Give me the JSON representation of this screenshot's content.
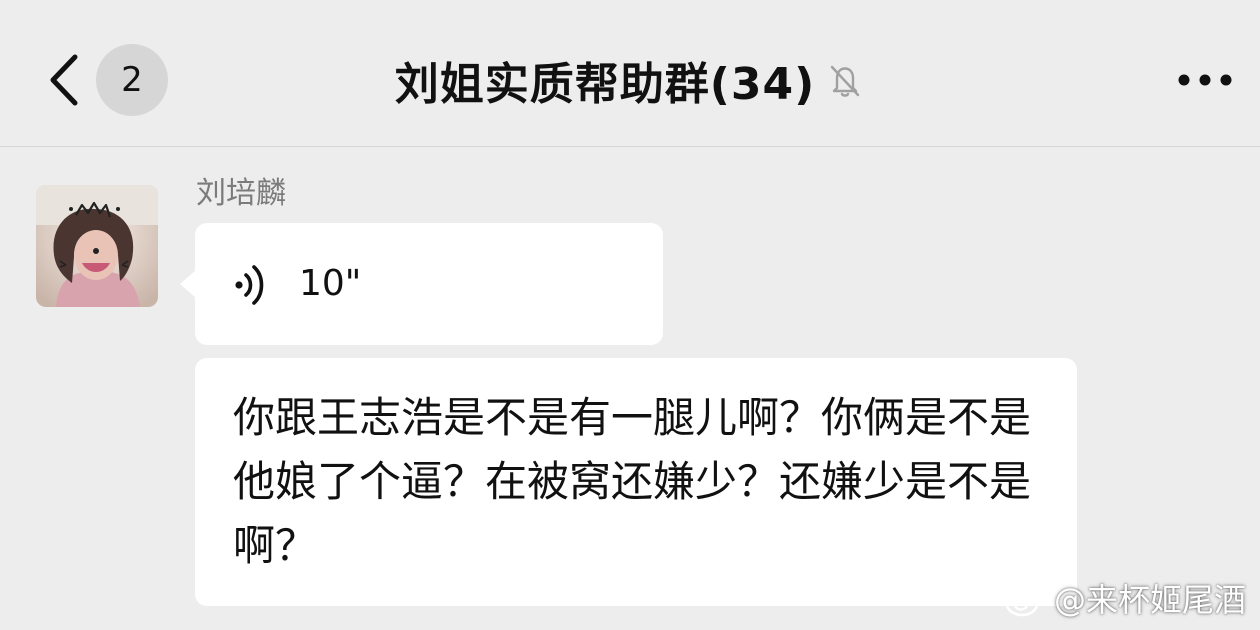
{
  "header": {
    "back_count": "2",
    "title": "刘姐实质帮助群(34)",
    "icons": {
      "back": "chevron-left-icon",
      "mute": "bell-slash-icon",
      "more": "more-dots-icon"
    }
  },
  "message": {
    "sender_name": "刘培麟",
    "avatar": "user-avatar",
    "voice": {
      "icon": "voice-wave-icon",
      "duration": "10\""
    },
    "text": "你跟王志浩是不是有一腿儿啊？你俩是不是他娘了个逼？在被窝还嫌少？还嫌少是不是啊？"
  },
  "watermark": {
    "logo": "weibo-logo-icon",
    "text": "@来杯姬尾酒"
  },
  "colors": {
    "background": "#ededed",
    "bubble": "#ffffff",
    "badge": "#d6d6d6",
    "sender_name": "#7b7b7b"
  }
}
